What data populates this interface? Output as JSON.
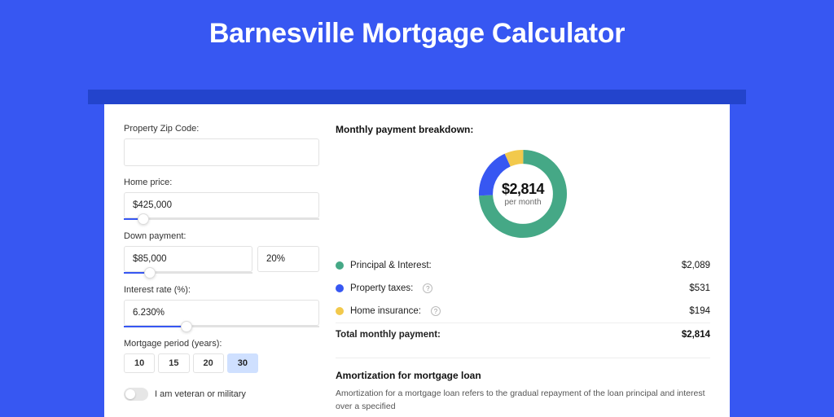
{
  "title": "Barnesville Mortgage Calculator",
  "left": {
    "zip_label": "Property Zip Code:",
    "zip_value": "",
    "home_price_label": "Home price:",
    "home_price_value": "$425,000",
    "home_price_pct": 10,
    "down_payment_label": "Down payment:",
    "down_payment_amount": "$85,000",
    "down_payment_pct_value": "20%",
    "down_payment_slider_pct": 20,
    "interest_label": "Interest rate (%):",
    "interest_value": "6.230%",
    "interest_slider_pct": 32,
    "period_label": "Mortgage period (years):",
    "periods": [
      "10",
      "15",
      "20",
      "30"
    ],
    "period_active": "30",
    "veteran_label": "I am veteran or military",
    "veteran_on": false
  },
  "right": {
    "breakdown_title": "Monthly payment breakdown:",
    "donut_value": "$2,814",
    "donut_sub": "per month",
    "legend": [
      {
        "key": "Principal & Interest:",
        "val": "$2,089",
        "color": "#45a886",
        "help": false
      },
      {
        "key": "Property taxes:",
        "val": "$531",
        "color": "#3757f2",
        "help": true
      },
      {
        "key": "Home insurance:",
        "val": "$194",
        "color": "#f2c94c",
        "help": true
      }
    ],
    "total_key": "Total monthly payment:",
    "total_val": "$2,814",
    "amort_title": "Amortization for mortgage loan",
    "amort_text": "Amortization for a mortgage loan refers to the gradual repayment of the loan principal and interest over a specified"
  },
  "chart_data": {
    "type": "pie",
    "title": "Monthly payment breakdown",
    "series": [
      {
        "name": "Principal & Interest",
        "value": 2089,
        "color": "#45a886"
      },
      {
        "name": "Property taxes",
        "value": 531,
        "color": "#3757f2"
      },
      {
        "name": "Home insurance",
        "value": 194,
        "color": "#f2c94c"
      }
    ],
    "total": 2814,
    "center_label": "$2,814 per month"
  }
}
